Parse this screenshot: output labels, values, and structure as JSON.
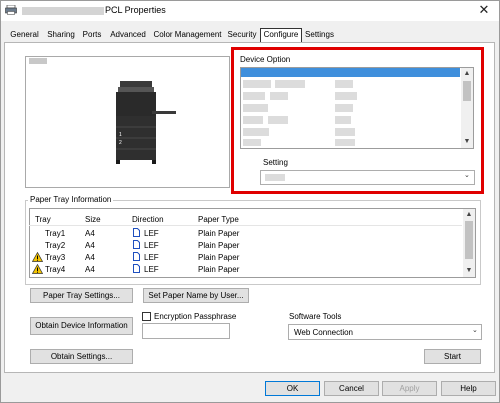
{
  "window": {
    "title": "PCL Properties",
    "close_glyph": "✕"
  },
  "tabs": [
    "General",
    "Sharing",
    "Ports",
    "Advanced",
    "Color Management",
    "Security",
    "Configure",
    "Settings"
  ],
  "selected_tab": "Configure",
  "device_option": {
    "label": "Device Option",
    "setting_label": "Setting",
    "setting_dropdown_glyph": "⌄"
  },
  "paper_tray": {
    "group_label": "Paper Tray Information",
    "columns": [
      "Tray",
      "Size",
      "Direction",
      "Paper Type"
    ],
    "rows": [
      {
        "tray": "Tray1",
        "size": "A4",
        "direction": "LEF",
        "paper_type": "Plain Paper",
        "warning": false
      },
      {
        "tray": "Tray2",
        "size": "A4",
        "direction": "LEF",
        "paper_type": "Plain Paper",
        "warning": false
      },
      {
        "tray": "Tray3",
        "size": "A4",
        "direction": "LEF",
        "paper_type": "Plain Paper",
        "warning": true
      },
      {
        "tray": "Tray4",
        "size": "A4",
        "direction": "LEF",
        "paper_type": "Plain Paper",
        "warning": true
      }
    ],
    "tray_settings_button": "Paper Tray Settings...",
    "set_paper_name_button": "Set Paper Name by User..."
  },
  "obtain_device_info_button": "Obtain Device Information",
  "encryption": {
    "label": "Encryption Passphrase",
    "checked": false,
    "value": ""
  },
  "software_tools": {
    "label": "Software Tools",
    "selected": "Web Connection",
    "start_button": "Start"
  },
  "obtain_settings_button": "Obtain Settings...",
  "footer": {
    "ok": "OK",
    "cancel": "Cancel",
    "apply": "Apply",
    "help": "Help"
  },
  "icons": {
    "printer": "printer-icon",
    "warning": "warning-icon",
    "page_orientation": "page-icon"
  },
  "colors": {
    "highlight_border": "#e00000",
    "selection": "#3f8fdc",
    "warning": "#f4c400"
  }
}
